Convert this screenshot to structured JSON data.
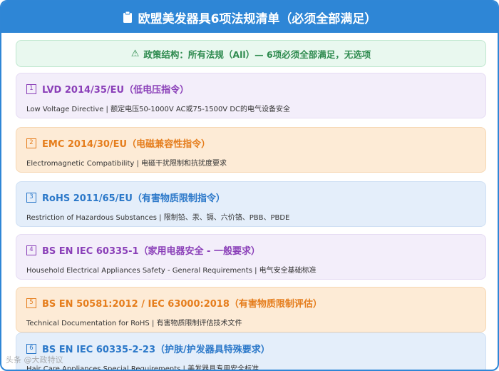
{
  "header": {
    "title": "欧盟美发器具6项法规清单（必须全部满足）",
    "icon": "clipboard-icon"
  },
  "policy": {
    "icon": "warning-icon",
    "text": "政策结构：所有法规（All）— 6项必须全部满足，无选项"
  },
  "items": [
    {
      "num": "1",
      "title": "LVD 2014/35/EU（低电压指令）",
      "desc": "Low Voltage Directive | 额定电压50-1000V AC或75-1500V DC的电气设备安全",
      "color": "#8a3fb8"
    },
    {
      "num": "2",
      "title": "EMC 2014/30/EU（电磁兼容性指令）",
      "desc": "Electromagnetic Compatibility | 电磁干扰限制和抗扰度要求",
      "color": "#e57d1c"
    },
    {
      "num": "3",
      "title": "RoHS 2011/65/EU（有害物质限制指令）",
      "desc": "Restriction of Hazardous Substances | 限制铅、汞、镉、六价铬、PBB、PBDE",
      "color": "#2b78c9"
    },
    {
      "num": "4",
      "title": "BS EN IEC 60335-1（家用电器安全 - 一般要求）",
      "desc": "Household Electrical Appliances Safety - General Requirements | 电气安全基础标准",
      "color": "#8a3fb8"
    },
    {
      "num": "5",
      "title": "BS EN 50581:2012 / IEC 63000:2018（有害物质限制评估）",
      "desc": "Technical Documentation for RoHS | 有害物质限制评估技术文件",
      "color": "#e57d1c"
    },
    {
      "num": "6",
      "title": "BS EN IEC 60335-2-23（护肤/护发器具特殊要求）",
      "desc": "Hair Care Appliances Special Requirements | 美发器具专用安全标准",
      "color": "#2b78c9"
    }
  ],
  "watermark": "头条 @大政特议"
}
